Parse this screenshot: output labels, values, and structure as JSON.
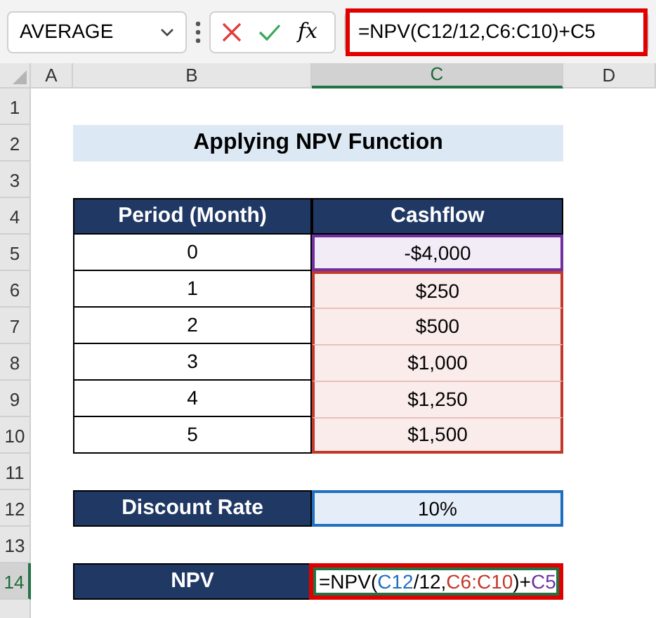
{
  "formula_bar": {
    "name_box": "AVERAGE",
    "function_label": "fx",
    "formula": "=NPV(C12/12,C6:C10)+C5"
  },
  "columns": [
    {
      "label": "A",
      "selected": false
    },
    {
      "label": "B",
      "selected": false
    },
    {
      "label": "C",
      "selected": true
    },
    {
      "label": "D",
      "selected": false
    }
  ],
  "row_numbers": [
    {
      "label": "1",
      "selected": false
    },
    {
      "label": "2",
      "selected": false
    },
    {
      "label": "3",
      "selected": false
    },
    {
      "label": "4",
      "selected": false
    },
    {
      "label": "5",
      "selected": false
    },
    {
      "label": "6",
      "selected": false
    },
    {
      "label": "7",
      "selected": false
    },
    {
      "label": "8",
      "selected": false
    },
    {
      "label": "9",
      "selected": false
    },
    {
      "label": "10",
      "selected": false
    },
    {
      "label": "11",
      "selected": false
    },
    {
      "label": "12",
      "selected": false
    },
    {
      "label": "13",
      "selected": false
    },
    {
      "label": "14",
      "selected": true
    }
  ],
  "title": "Applying NPV Function",
  "table": {
    "columns": [
      "Period (Month)",
      "Cashflow"
    ],
    "rows": [
      {
        "period": "0",
        "cashflow": "-$4,000",
        "color": "#7030a0"
      },
      {
        "period": "1",
        "cashflow": "$250",
        "color": "#c0392b"
      },
      {
        "period": "2",
        "cashflow": "$500",
        "color": "#c0392b"
      },
      {
        "period": "3",
        "cashflow": "$1,000",
        "color": "#c0392b"
      },
      {
        "period": "4",
        "cashflow": "$1,250",
        "color": "#c0392b"
      },
      {
        "period": "5",
        "cashflow": "$1,500",
        "color": "#c0392b"
      }
    ]
  },
  "discount": {
    "label": "Discount Rate",
    "value": "10%",
    "color": "#1f6fc0"
  },
  "npv": {
    "label": "NPV",
    "formula_parts": [
      {
        "text": "=NPV(",
        "color": "#000000"
      },
      {
        "text": "C12",
        "color": "#1f6fc0"
      },
      {
        "text": "/12,",
        "color": "#000000"
      },
      {
        "text": "C6:C10",
        "color": "#c0392b"
      },
      {
        "text": ")+",
        "color": "#000000"
      },
      {
        "text": "C5",
        "color": "#7030a0"
      }
    ]
  }
}
